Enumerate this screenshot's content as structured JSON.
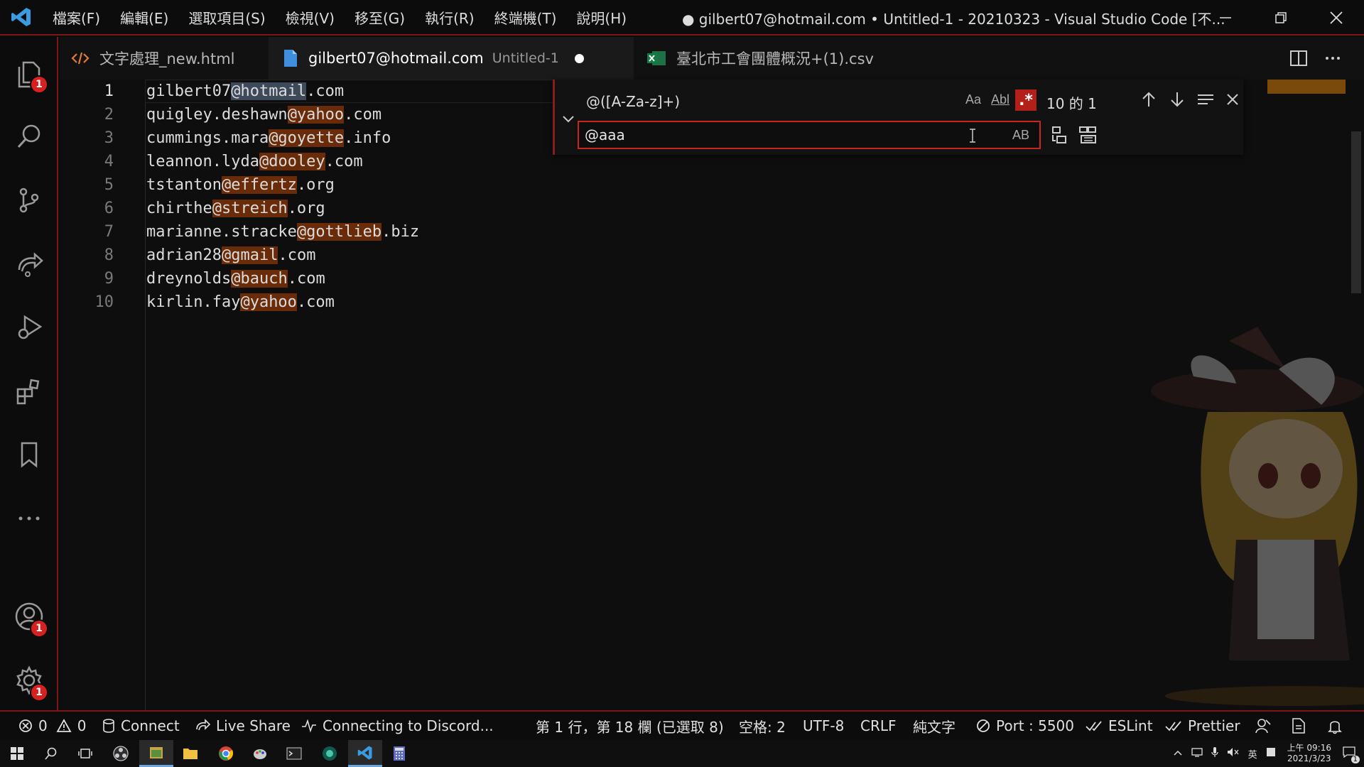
{
  "titlebar": {
    "menus": [
      "檔案(F)",
      "編輯(E)",
      "選取項目(S)",
      "檢視(V)",
      "移至(G)",
      "執行(R)",
      "終端機(T)",
      "說明(H)"
    ],
    "window_title": "● gilbert07@hotmail.com • Untitled-1 - 20210323 - Visual Studio Code [不..."
  },
  "activity_bar": {
    "explorer_badge": "1",
    "accounts_badge": "1",
    "settings_badge": "1"
  },
  "tabs": [
    {
      "label": "文字處理_new.html",
      "sub": ""
    },
    {
      "label": "gilbert07@hotmail.com",
      "sub": "Untitled-1"
    },
    {
      "label": "臺北市工會團體概況+(1).csv",
      "sub": ""
    }
  ],
  "editor": {
    "line_numbers": [
      "1",
      "2",
      "3",
      "4",
      "5",
      "6",
      "7",
      "8",
      "9",
      "10"
    ],
    "lines": [
      {
        "pre": "gilbert07",
        "match": "@hotmail",
        "post": ".com"
      },
      {
        "pre": "quigley.deshawn",
        "match": "@yahoo",
        "post": ".com"
      },
      {
        "pre": "cummings.mara",
        "match": "@goyette",
        "post": ".info"
      },
      {
        "pre": "leannon.lyda",
        "match": "@dooley",
        "post": ".com"
      },
      {
        "pre": "tstanton",
        "match": "@effertz",
        "post": ".org"
      },
      {
        "pre": "chirthe",
        "match": "@streich",
        "post": ".org"
      },
      {
        "pre": "marianne.stracke",
        "match": "@gottlieb",
        "post": ".biz"
      },
      {
        "pre": "adrian28",
        "match": "@gmail",
        "post": ".com"
      },
      {
        "pre": "dreynolds",
        "match": "@bauch",
        "post": ".com"
      },
      {
        "pre": "kirlin.fay",
        "match": "@yahoo",
        "post": ".com"
      }
    ]
  },
  "find_widget": {
    "find_value": "@([A-Za-z]+)",
    "replace_value": "@aaa",
    "match_case_label": "Aa",
    "whole_word_label": "Abl",
    "regex_label": ".*",
    "preserve_case_label": "AB",
    "match_count": "10 的 1"
  },
  "statusbar": {
    "errors": "0",
    "warnings": "0",
    "connect": "Connect",
    "live_share": "Live Share",
    "discord": "Connecting to Discord...",
    "position": "第 1 行，第 18 欄 (已選取 8)",
    "spaces": "空格: 2",
    "encoding": "UTF-8",
    "eol": "CRLF",
    "language": "純文字",
    "port": "Port : 5500",
    "eslint": "ESLint",
    "prettier": "Prettier"
  },
  "taskbar": {
    "ime": "英",
    "clock_time": "上午 09:16",
    "clock_date": "2021/3/23",
    "notification_count": "1"
  },
  "colors": {
    "accent_red": "#7d1616",
    "match_highlight": "#6a2c08",
    "regex_active": "#b3201a",
    "badge": "#d62121"
  }
}
